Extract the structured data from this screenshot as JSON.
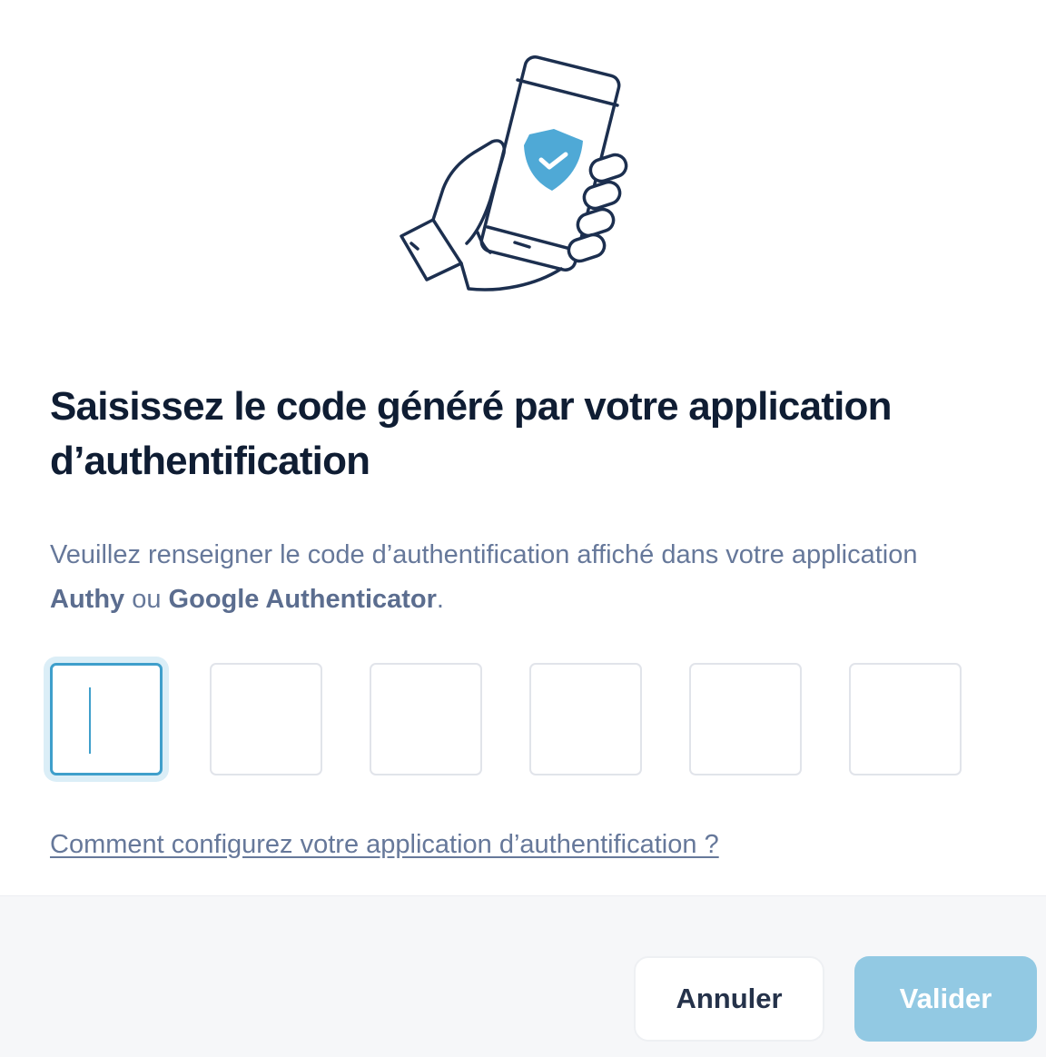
{
  "dialog": {
    "title": "Saisissez le code généré par votre application d’authentification",
    "description": {
      "part1": "Veuillez renseigner le code d’authentification affiché dans votre application ",
      "app1": "Authy",
      "part2": " ou ",
      "app2": "Google Authenticator",
      "part3": "."
    },
    "otp": {
      "digits": [
        "",
        "",
        "",
        "",
        "",
        ""
      ],
      "focused_index": 0
    },
    "help_link": "Comment configurez votre application d’authentification ?",
    "cancel_label": "Annuler",
    "submit_label": "Valider"
  },
  "icons": {
    "illustration": "hand-holding-phone-shield-icon",
    "badge": "shield-check-icon"
  },
  "colors": {
    "accent": "#3f9fcb",
    "submit_disabled": "#92c9e3",
    "title": "#0f1d33",
    "text": "#66789a",
    "illustration_stroke": "#1c2f4f"
  }
}
